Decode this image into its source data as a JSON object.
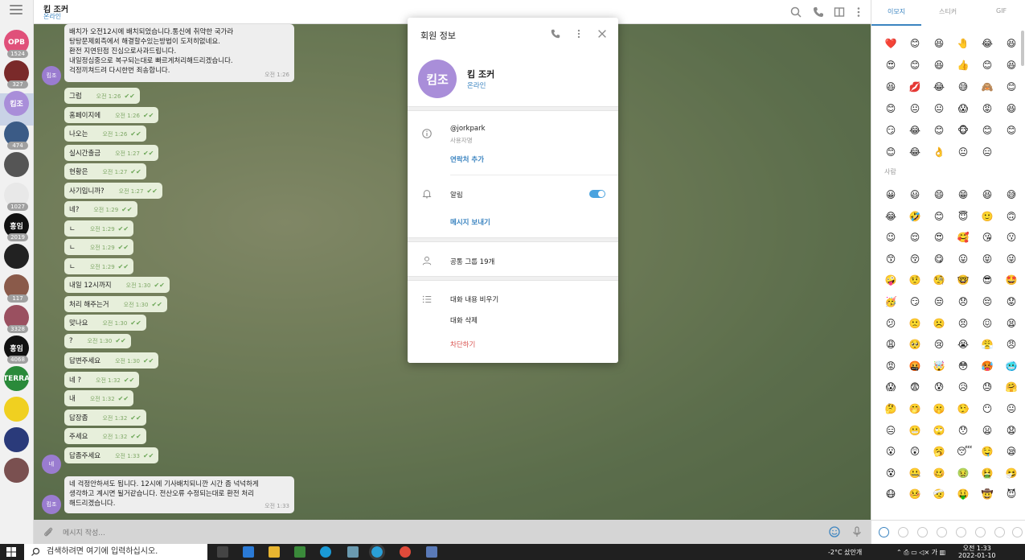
{
  "chat": {
    "title": "킴 조커",
    "status": "온라인",
    "composer_placeholder": "메시지 작성...",
    "top_message_lines": [
      "배치가 오전12시에 배치되었습니다.통신에 취약한 국가라",
      "탕탕문제회측에서 해결할수있는방법이 도저히없네요.",
      "환전 지연된점 진심으로사과드립니다.",
      "내일정심중으로 복구되는대로 빠르게처리해드리겠습니다.",
      "걱정끼쳐드려 다시한번 죄송합니다."
    ],
    "top_message_time": "오전 1:26",
    "avatar_label": "킴조",
    "messages": [
      {
        "text": "그럼",
        "time": "오전 1:26"
      },
      {
        "text": "홈페이지에",
        "time": "오전 1:26"
      },
      {
        "text": "나오는",
        "time": "오전 1:26"
      },
      {
        "text": "실시간출금",
        "time": "오전 1:27"
      },
      {
        "text": "현황은",
        "time": "오전 1:27"
      },
      {
        "text": "사기입니까?",
        "time": "오전 1:27"
      },
      {
        "text": "네?",
        "time": "오전 1:29"
      },
      {
        "text": "ㄴ",
        "time": "오전 1:29"
      },
      {
        "text": "ㄴ",
        "time": "오전 1:29"
      },
      {
        "text": "ㄴ",
        "time": "오전 1:29"
      },
      {
        "text": "내일 12시까지",
        "time": "오전 1:30"
      },
      {
        "text": "처리 해주는거",
        "time": "오전 1:30"
      },
      {
        "text": "맞나요",
        "time": "오전 1:30"
      },
      {
        "text": "?",
        "time": "오전 1:30"
      },
      {
        "text": "답변주세요",
        "time": "오전 1:30"
      },
      {
        "text": "네 ?",
        "time": "오전 1:32"
      },
      {
        "text": "내",
        "time": "오전 1:32"
      },
      {
        "text": "답장좀",
        "time": "오전 1:32"
      },
      {
        "text": "주세요",
        "time": "오전 1:32"
      },
      {
        "text": "답좀주세요",
        "time": "오전 1:33"
      }
    ],
    "bottom_message_lines": [
      "네 걱정안하셔도 됩니다. 12시에 기사배치되니깐 시간 좀 넉넉하게",
      "생각하고 계시면 될거같습니다. 전산오류 수정되는대로 환전 처리",
      "해드리겠습니다."
    ],
    "bottom_message_time": "오전 1:33",
    "small_avatar_label": "네"
  },
  "sidebar": {
    "chats": [
      {
        "label": "OPB",
        "badge": "1524",
        "color": "#e0507a"
      },
      {
        "label": "",
        "badge": "327",
        "color": "#7a2a2a"
      },
      {
        "label": "킴조",
        "badge": "",
        "color": "#a98ed9"
      },
      {
        "label": "",
        "badge": "474",
        "color": "#3b5b86"
      },
      {
        "label": "",
        "badge": "",
        "color": "#555555"
      },
      {
        "label": "",
        "badge": "1027",
        "color": "#e8e8e8"
      },
      {
        "label": "홍임",
        "badge": "2019",
        "color": "#111111"
      },
      {
        "label": "",
        "badge": "",
        "color": "#222222"
      },
      {
        "label": "",
        "badge": "117",
        "color": "#8a5a4a"
      },
      {
        "label": "",
        "badge": "3328",
        "color": "#9a5060"
      },
      {
        "label": "홍임",
        "badge": "4068",
        "color": "#111111"
      },
      {
        "label": "TERRA",
        "badge": "",
        "color": "#2a8a3a"
      },
      {
        "label": "",
        "badge": "",
        "color": "#f0d020"
      },
      {
        "label": "",
        "badge": "",
        "color": "#2a3a7a"
      },
      {
        "label": "",
        "badge": "",
        "color": "#7a5050"
      }
    ]
  },
  "modal": {
    "title": "회원 정보",
    "avatar_label": "킴조",
    "name": "킴 조커",
    "status": "온라인",
    "username": "@jorkpark",
    "username_label": "사용자명",
    "add_contact": "연락처 추가",
    "notifications": "알림",
    "notifications_on": true,
    "send_message": "메시지 보내기",
    "common_groups": "공통 그룹 19개",
    "clear_history": "대화 내용 비우기",
    "delete_chat": "대화 삭제",
    "block": "차단하기"
  },
  "emoji_panel": {
    "tabs": [
      "이모지",
      "스티커",
      "GIF"
    ],
    "active_tab": 0,
    "section_label": "사람",
    "recent": [
      "❤️",
      "😊",
      "😆",
      "🤚",
      "😂",
      "😆",
      "😍",
      "😊",
      "😆",
      "👍",
      "😊",
      "😆",
      "😆",
      "💋",
      "😂",
      "😅",
      "🙈",
      "😊",
      "😊",
      "😐",
      "😐",
      "😱",
      "😡",
      "😆",
      "😏",
      "😂",
      "😊",
      "🐵",
      "😊",
      "😊",
      "😊",
      "😂",
      "👌",
      "😐",
      "😑"
    ],
    "people": [
      "😀",
      "😃",
      "😄",
      "😁",
      "😆",
      "😅",
      "😂",
      "🤣",
      "😊",
      "😇",
      "🙂",
      "🙃",
      "😉",
      "😌",
      "😍",
      "🥰",
      "😘",
      "😗",
      "😙",
      "😚",
      "😋",
      "😛",
      "😝",
      "😜",
      "🤪",
      "🤨",
      "🧐",
      "🤓",
      "😎",
      "🤩",
      "🥳",
      "😏",
      "😒",
      "😞",
      "😔",
      "😟",
      "😕",
      "🙁",
      "☹️",
      "😣",
      "😖",
      "😫",
      "😩",
      "🥺",
      "😢",
      "😭",
      "😤",
      "😠",
      "😡",
      "🤬",
      "🤯",
      "😳",
      "🥵",
      "🥶",
      "😱",
      "😨",
      "😰",
      "😥",
      "😓",
      "🤗",
      "🤔",
      "🤭",
      "🤫",
      "🤥",
      "😶",
      "😐",
      "😑",
      "😬",
      "🙄",
      "😯",
      "😦",
      "😧",
      "😮",
      "😲",
      "🥱",
      "😴",
      "🤤",
      "😪",
      "😵",
      "🤐",
      "🥴",
      "🤢",
      "🤮",
      "🤧",
      "😷",
      "🤒",
      "🤕",
      "🤑",
      "🤠",
      "😈"
    ]
  },
  "taskbar": {
    "search_placeholder": "검색하려면 여기에 입력하십시오.",
    "weather": "-2°C  샀안개",
    "time": "오전 1:33",
    "date": "2022-01-10"
  }
}
